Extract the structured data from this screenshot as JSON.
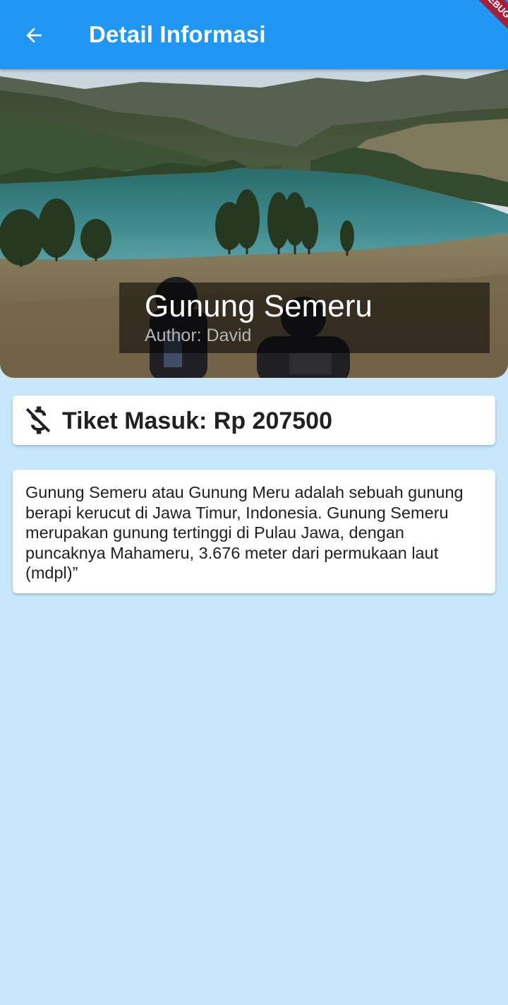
{
  "appbar": {
    "title": "Detail Informasi",
    "back_icon": "arrow-back-icon",
    "debug_banner": "DEBUG",
    "color": "#2196f3"
  },
  "hero": {
    "title": "Gunung Semeru",
    "author": "Author: David"
  },
  "ticket": {
    "icon": "money-off-icon",
    "label": "Tiket Masuk: Rp 207500"
  },
  "description": {
    "text": "Gunung Semeru atau Gunung Meru adalah sebuah gunung berapi kerucut di Jawa Timur, Indonesia. Gunung Semeru merupakan gunung tertinggi di Pulau Jawa, dengan puncaknya Mahameru, 3.676 meter dari permukaan laut (mdpl)”"
  },
  "colors": {
    "background": "#c7e8fb",
    "card": "#ffffff",
    "text": "#212121"
  }
}
